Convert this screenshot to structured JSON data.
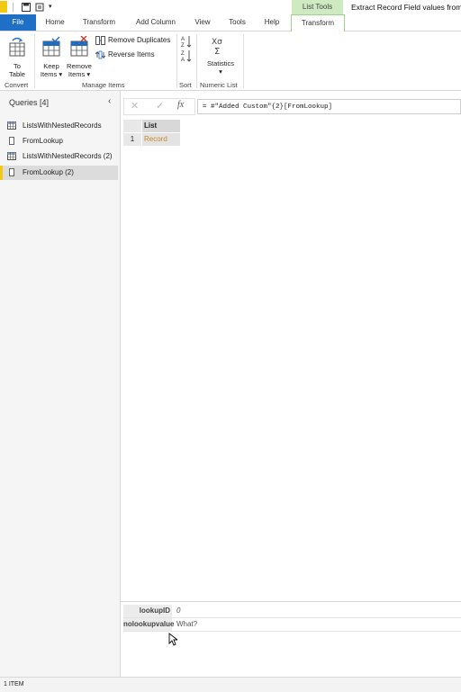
{
  "window": {
    "title": "Extract Record Field values from"
  },
  "contextual_tab": "List Tools",
  "tabs": [
    "File",
    "Home",
    "Transform",
    "Add Column",
    "View",
    "Tools",
    "Help",
    "Transform"
  ],
  "ribbon": {
    "to_table": {
      "line1": "To",
      "line2": "Table"
    },
    "keep_items": {
      "line1": "Keep",
      "line2": "Items ▾"
    },
    "remove_items": {
      "line1": "Remove",
      "line2": "Items ▾"
    },
    "remove_duplicates": "Remove Duplicates",
    "reverse_items": "Reverse Items",
    "statistics": {
      "label": "Statistics",
      "arrow": "▾"
    },
    "groups": {
      "convert": "Convert",
      "manage": "Manage Items",
      "sort": "Sort",
      "numeric": "Numeric List"
    }
  },
  "queries": {
    "header": "Queries [4]",
    "items": [
      {
        "label": "ListsWithNestedRecords",
        "icon": "table-icon"
      },
      {
        "label": "FromLookup",
        "icon": "list-icon"
      },
      {
        "label": "ListsWithNestedRecords (2)",
        "icon": "table-icon"
      },
      {
        "label": "FromLookup (2)",
        "icon": "list-icon",
        "selected": true
      }
    ]
  },
  "formula": {
    "text": "= #\"Added Custom\"{2}[FromLookup]",
    "fx": "fx"
  },
  "grid": {
    "column": "List",
    "row_number": "1",
    "cell": "Record"
  },
  "details": [
    {
      "key": "lookupID",
      "value": "0"
    },
    {
      "key": "nolookupvalue",
      "value": "What?"
    }
  ],
  "status": "1 ITEM",
  "colors": {
    "file_tab": "#1f6fc7",
    "list_tools": "#cdeac0",
    "record_link": "#c8862a",
    "selected_query": "#dcdcdc",
    "accent_bar": "#f2c811"
  }
}
